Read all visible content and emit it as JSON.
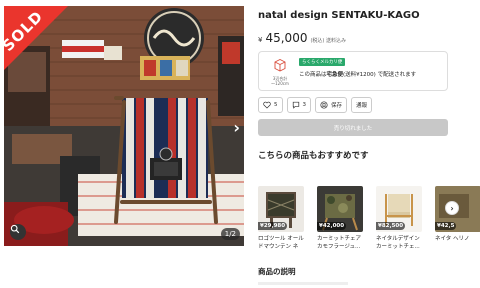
{
  "product": {
    "title": "natal design SENTAKU-KAGO",
    "price_currency": "¥",
    "price": "45,000",
    "price_note": "(税込) 送料込み",
    "sold_label": "SOLD",
    "image_counter": "1/2"
  },
  "shipping": {
    "icon_label_1": "3辺合計",
    "icon_label_2": "〜120cm",
    "tag": "らくらくメルカリ便",
    "text_prefix": "この商品は",
    "text_bold": "宅急便",
    "text_suffix": "(送料¥1200) で配送されます"
  },
  "actions": {
    "likes_count": "5",
    "comments_count": "3",
    "save_label": "保存",
    "report_label": "通報"
  },
  "buy_button": {
    "label": "売り切れました"
  },
  "recommendations": {
    "title": "こちらの商品もおすすめです",
    "items": [
      {
        "price": "¥29,980",
        "name": "ロゴツール オールドマウンテン ネ"
      },
      {
        "price": "¥42,000",
        "name": "カーミットチェア カモフラージュ..."
      },
      {
        "price": "¥82,500",
        "name": "ネイタルデザイン カーミットチェ..."
      },
      {
        "price": "¥42,5",
        "name": "ネイタ ヘリノ"
      }
    ],
    "next_icon": "chevron-right-icon"
  },
  "description": {
    "title": "商品の説明"
  },
  "colors": {
    "sold_red": "#ea352d",
    "ship_green": "#2aa86b",
    "button_disabled": "#c8c8c8"
  }
}
